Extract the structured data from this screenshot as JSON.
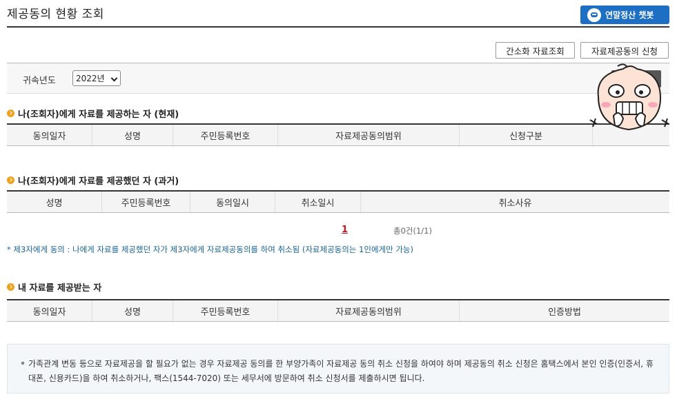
{
  "header": {
    "title": "제공동의 현황 조회",
    "chatbot_label": "연말정산 챗봇"
  },
  "actions": {
    "simple_lookup": "간소화 자료조회",
    "apply_consent": "자료제공동의 신청"
  },
  "filter": {
    "label": "귀속년도",
    "year_selected": "2022년"
  },
  "section_current": {
    "title": "나(조회자)에게 자료를 제공하는 자 (현재)",
    "columns": [
      "동의일자",
      "성명",
      "주민등록번호",
      "자료제공동의범위",
      "신청구분",
      ""
    ]
  },
  "section_past": {
    "title": "나(조회자)에게 자료를 제공했던 자 (과거)",
    "columns": [
      "성명",
      "주민등록번호",
      "동의일시",
      "취소일시",
      "취소사유"
    ],
    "pager": {
      "current_page": "1",
      "total_label": "총0건(1/1)"
    },
    "note": "* 제3자에게 동의 : 나에게 자료를 제공했던 자가 제3자에게 자료제공동의를 하여 취소됨 (자료제공동의는 1인에게만 가능)"
  },
  "section_receiving": {
    "title": "내 자료를 제공받는 자",
    "columns": [
      "동의일자",
      "성명",
      "주민등록번호",
      "자료제공동의범위",
      "인증방법"
    ]
  },
  "info": {
    "text": "가족관계 변동 등으로 자료제공을 할 필요가 없는 경우 자료제공 동의를 한 부양가족이 자료제공 동의 취소 신청을 하여야 하며 제공동의 취소 신청은 홈택스에서 본인 인증(인증서, 휴대폰, 신용카드)을 하여 취소하거나, 팩스(1544-7020) 또는 세무서에 방문하여 취소 신청서를 제출하시면 됩니다."
  },
  "colors": {
    "primary_blue": "#1d6fc4",
    "accent_orange": "#f0a11c",
    "pager_red": "#c8151d",
    "note_blue": "#1a6496"
  }
}
